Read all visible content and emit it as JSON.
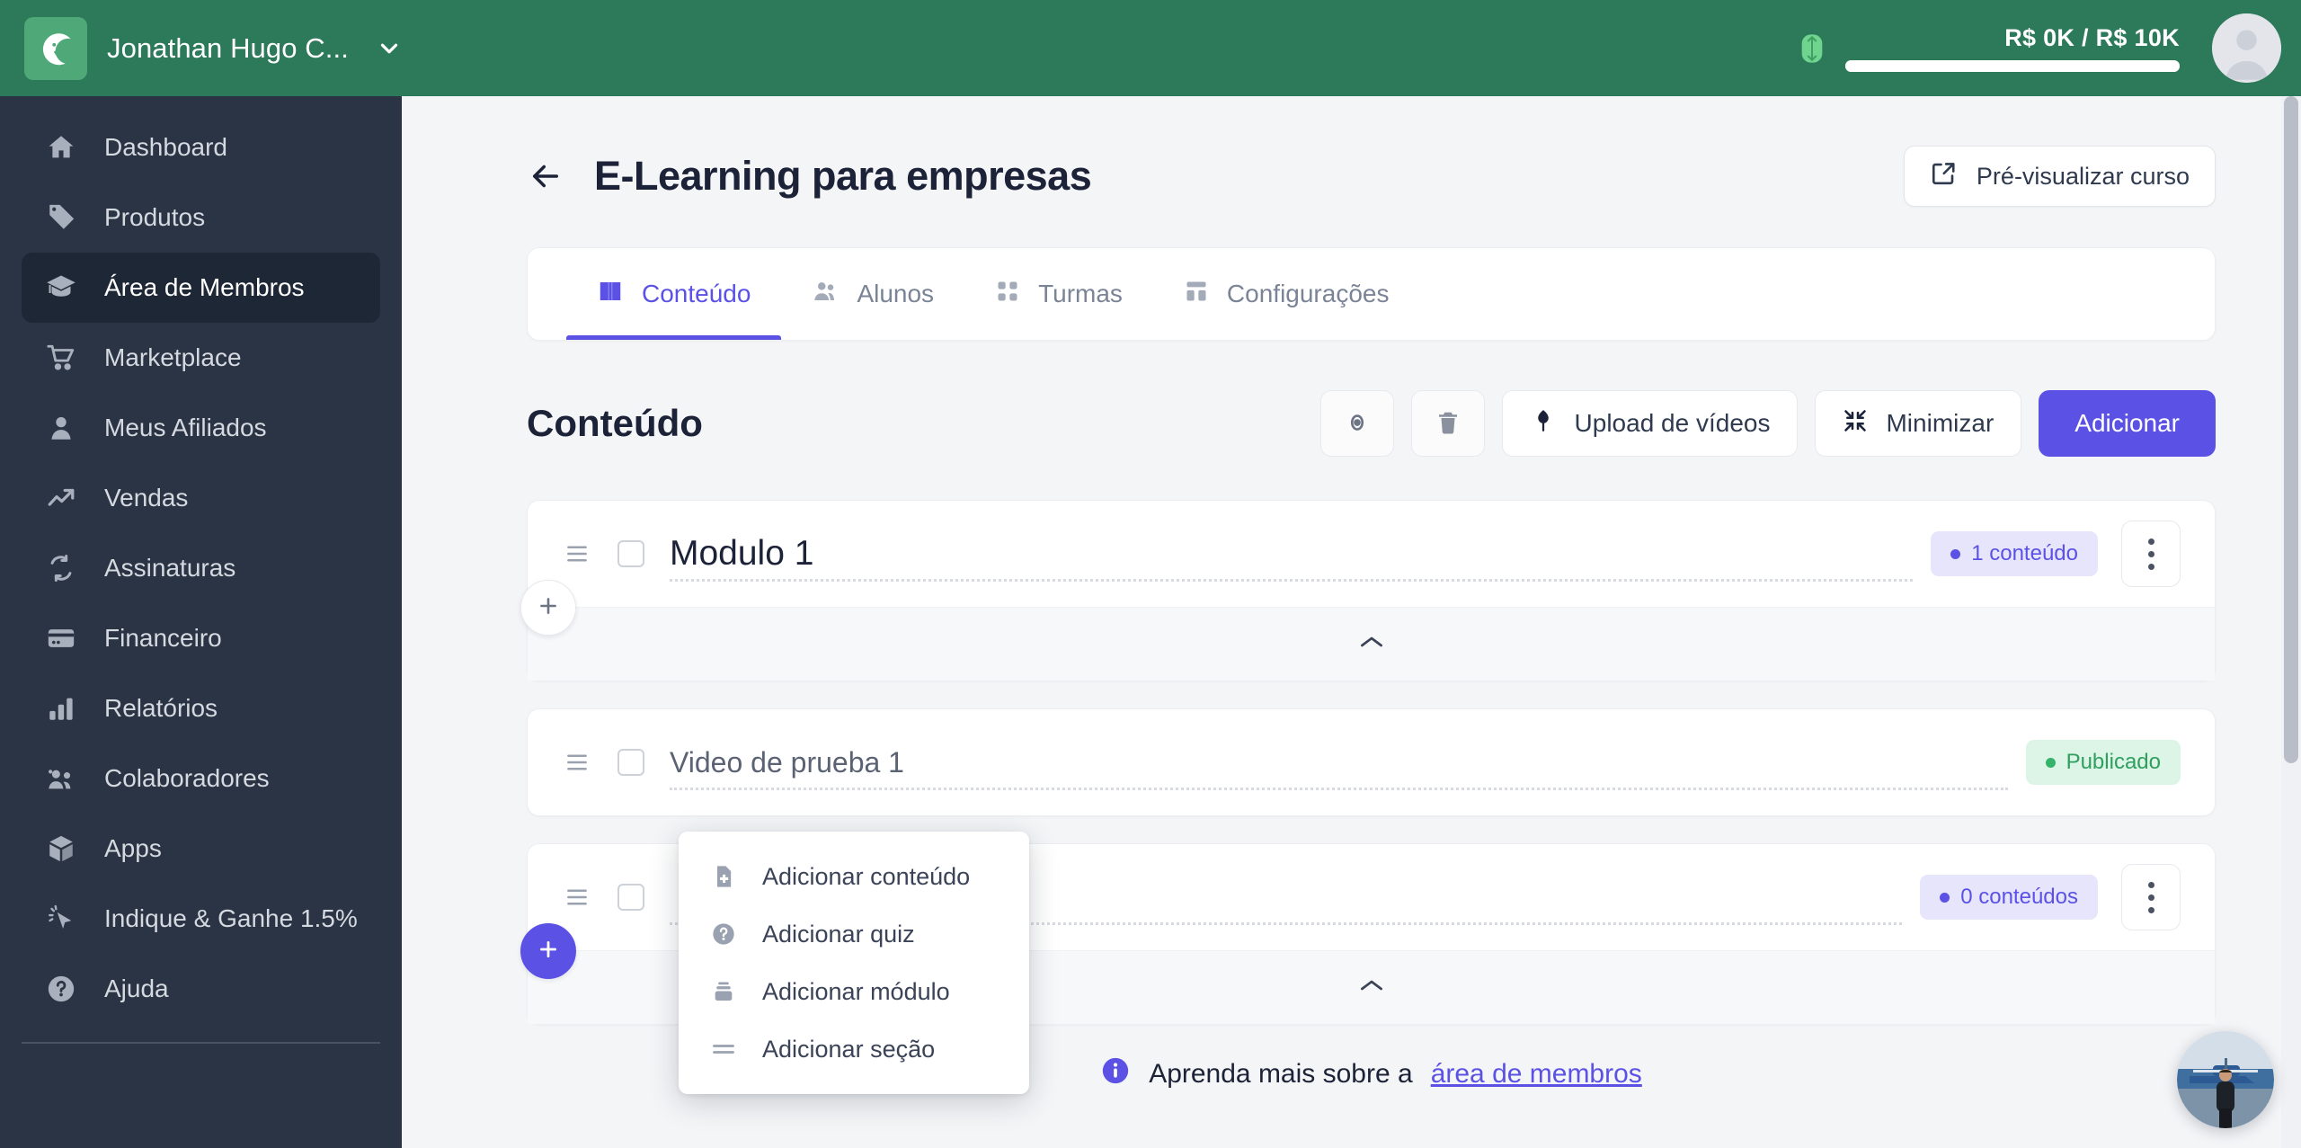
{
  "topbar": {
    "brand_name": "Jonathan Hugo C...",
    "logo_icon": "crescent-leaf-logo",
    "caret_icon": "chevron-down-icon",
    "gem_icon": "gem-icon",
    "gauge_label": "R$ 0K / R$ 10K",
    "gauge_percent": 0,
    "avatar_icon": "user-avatar-placeholder",
    "bg_color": "#2d7a5a"
  },
  "sidebar": {
    "bg_color": "#2b3445",
    "active_bg_color": "#1e2736",
    "items": [
      {
        "label": "Dashboard",
        "icon": "home-icon",
        "active": false
      },
      {
        "label": "Produtos",
        "icon": "tag-icon",
        "active": false
      },
      {
        "label": "Área de Membros",
        "icon": "graduation-cap-icon",
        "active": true
      },
      {
        "label": "Marketplace",
        "icon": "shopping-cart-icon",
        "active": false
      },
      {
        "label": "Meus Afiliados",
        "icon": "person-icon",
        "active": false
      },
      {
        "label": "Vendas",
        "icon": "trending-up-icon",
        "active": false
      },
      {
        "label": "Assinaturas",
        "icon": "refresh-cycle-icon",
        "active": false
      },
      {
        "label": "Financeiro",
        "icon": "credit-card-icon",
        "active": false
      },
      {
        "label": "Relatórios",
        "icon": "bar-chart-icon",
        "active": false
      },
      {
        "label": "Colaboradores",
        "icon": "people-group-icon",
        "active": false
      },
      {
        "label": "Apps",
        "icon": "cube-icon",
        "active": false
      },
      {
        "label": "Indique & Ganhe 1.5%",
        "icon": "cursor-click-icon",
        "active": false
      },
      {
        "label": "Ajuda",
        "icon": "question-circle-icon",
        "active": false
      }
    ]
  },
  "page": {
    "back_icon": "arrow-left-icon",
    "title": "E-Learning para empresas",
    "preview_button": {
      "label": "Pré-visualizar curso",
      "icon": "external-link-icon"
    }
  },
  "tabs": [
    {
      "label": "Conteúdo",
      "icon": "book-icon",
      "active": true
    },
    {
      "label": "Alunos",
      "icon": "people-icon",
      "active": false
    },
    {
      "label": "Turmas",
      "icon": "grid-squares-icon",
      "active": false
    },
    {
      "label": "Configurações",
      "icon": "layout-icon",
      "active": false
    }
  ],
  "content": {
    "heading": "Conteúdo",
    "accent_color": "#5b52e5",
    "actions": {
      "preview_eye": {
        "icon": "eye-icon",
        "label": ""
      },
      "delete": {
        "icon": "trash-icon",
        "label": ""
      },
      "upload": {
        "icon": "upload-cloud-icon",
        "label": "Upload de vídeos"
      },
      "minimize": {
        "icon": "minimize-icon",
        "label": "Minimizar"
      },
      "add": {
        "label": "Adicionar"
      }
    }
  },
  "modules": [
    {
      "title": "Modulo 1",
      "badge": {
        "text": "1 conteúdo",
        "color": "purple"
      },
      "drag_icon": "drag-handle-icon",
      "kebab_icon": "more-vertical-icon",
      "collapse_icon": "chevron-up-icon",
      "plus_icon": "plus-icon",
      "plus_active": false
    },
    {
      "title": "",
      "badge": {
        "text": "0 conteúdos",
        "color": "purple"
      },
      "drag_icon": "drag-handle-icon",
      "kebab_icon": "more-vertical-icon",
      "collapse_icon": "chevron-up-icon",
      "plus_icon": "plus-icon",
      "plus_active": true
    }
  ],
  "lessons": [
    {
      "title": "Video de prueba 1",
      "badge": {
        "text": "Publicado",
        "color": "green"
      },
      "drag_icon": "drag-handle-icon"
    }
  ],
  "dropdown": {
    "visible": true,
    "items": [
      {
        "label": "Adicionar conteúdo",
        "icon": "file-plus-icon"
      },
      {
        "label": "Adicionar quiz",
        "icon": "question-circle-icon"
      },
      {
        "label": "Adicionar módulo",
        "icon": "module-stack-icon"
      },
      {
        "label": "Adicionar seção",
        "icon": "section-lines-icon"
      }
    ]
  },
  "footer": {
    "info_icon": "info-circle-icon",
    "text": "Aprenda mais sobre a",
    "link_label": "área de membros"
  },
  "chat_widget": {
    "icon": "user-photo-avatar"
  }
}
